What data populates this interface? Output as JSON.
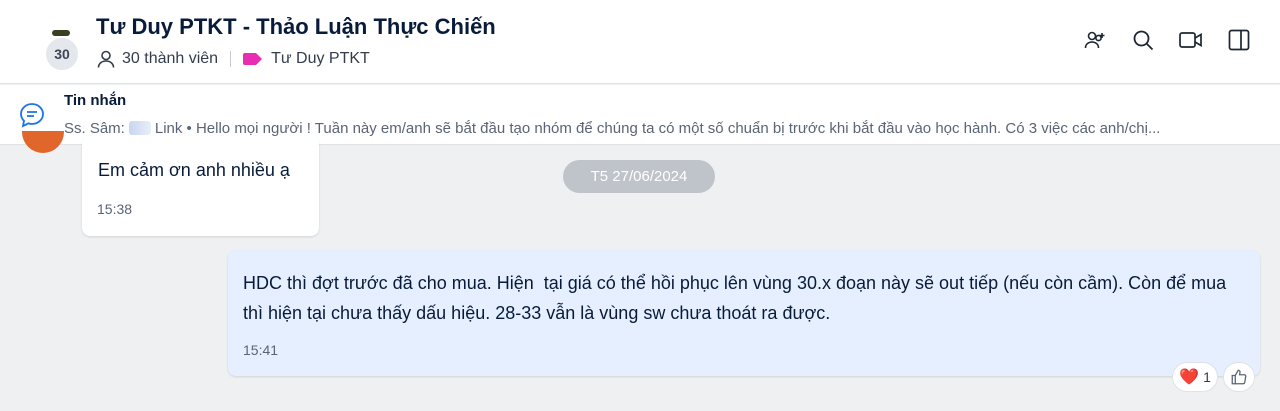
{
  "header": {
    "avatar_count": "30",
    "title": "Tư Duy PTKT - Thảo Luận Thực Chiến",
    "members": "30 thành viên",
    "tag_label": "Tư Duy PTKT",
    "tag_color": "#e62db3",
    "icons": [
      "add-member-icon",
      "search-icon",
      "video-call-icon",
      "toggle-panel-icon"
    ]
  },
  "pinned": {
    "label": "Tin nhắn",
    "sender": "Ss. Sâm:",
    "text": "Link • Hello mọi người ! Tuần này em/anh sẽ bắt đầu tạo nhóm để chúng ta có một số chuẩn bị trước khi bắt đầu vào học hành. Có 3 việc các anh/chị..."
  },
  "messages": [
    {
      "text": "Em cảm ơn anh nhiều ạ",
      "time": "15:38"
    },
    {
      "text": "HDC thì đợt trước đã cho mua. Hiện  tại giá có thể hồi phục lên vùng 30.x đoạn này sẽ out tiếp (nếu còn cầm). Còn để mua thì hiện tại chưa thấy dấu hiệu. 28-33 vẫn là vùng sw chưa thoát ra được.",
      "time": "15:41"
    }
  ],
  "date_divider": "T5 27/06/2024",
  "reaction": {
    "emoji": "❤️",
    "count": "1"
  }
}
